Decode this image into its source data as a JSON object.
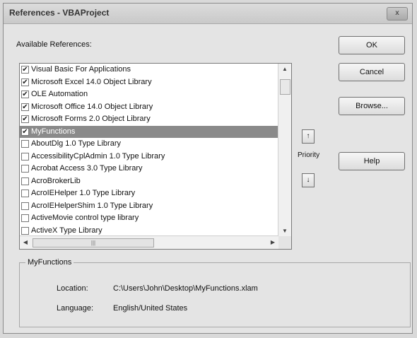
{
  "window": {
    "title": "References - VBAProject",
    "close_label": "x"
  },
  "available_label": "Available References:",
  "references": [
    {
      "label": "Visual Basic For Applications",
      "checked": true,
      "selected": false
    },
    {
      "label": "Microsoft Excel 14.0 Object Library",
      "checked": true,
      "selected": false
    },
    {
      "label": "OLE Automation",
      "checked": true,
      "selected": false
    },
    {
      "label": "Microsoft Office 14.0 Object Library",
      "checked": true,
      "selected": false
    },
    {
      "label": "Microsoft Forms 2.0 Object Library",
      "checked": true,
      "selected": false
    },
    {
      "label": "MyFunctions",
      "checked": true,
      "selected": true
    },
    {
      "label": "AboutDlg 1.0 Type Library",
      "checked": false,
      "selected": false
    },
    {
      "label": "AccessibilityCplAdmin 1.0 Type Library",
      "checked": false,
      "selected": false
    },
    {
      "label": "Acrobat Access 3.0 Type Library",
      "checked": false,
      "selected": false
    },
    {
      "label": "AcroBrokerLib",
      "checked": false,
      "selected": false
    },
    {
      "label": "AcroIEHelper 1.0 Type Library",
      "checked": false,
      "selected": false
    },
    {
      "label": "AcroIEHelperShim 1.0 Type Library",
      "checked": false,
      "selected": false
    },
    {
      "label": "ActiveMovie control type library",
      "checked": false,
      "selected": false
    },
    {
      "label": "ActiveX Type Library",
      "checked": false,
      "selected": false
    }
  ],
  "buttons": {
    "ok": "OK",
    "cancel": "Cancel",
    "browse": "Browse...",
    "help": "Help"
  },
  "priority": {
    "label": "Priority",
    "up_symbol": "↑",
    "down_symbol": "↓"
  },
  "selected_reference": {
    "name": "MyFunctions",
    "location_label": "Location:",
    "location_value": "C:\\Users\\John\\Desktop\\MyFunctions.xlam",
    "language_label": "Language:",
    "language_value": "English/United States"
  }
}
